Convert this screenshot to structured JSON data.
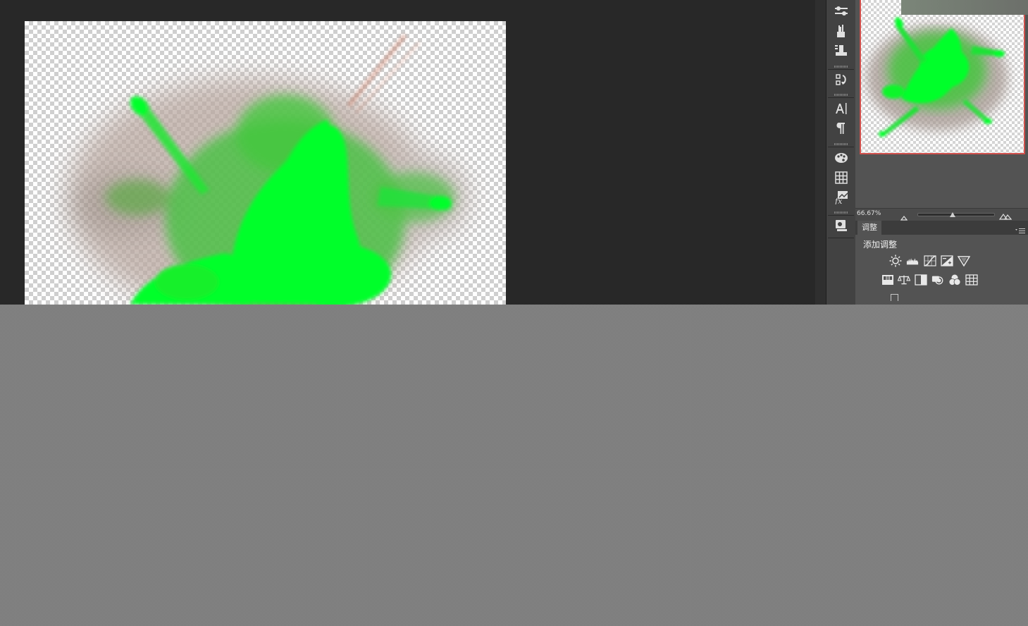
{
  "navigator": {
    "zoom_label": "66.67%"
  },
  "adjustments": {
    "tab_label": "调整",
    "add_adjustment_label": "添加调整",
    "row1_icons": [
      "brightness-contrast-icon",
      "levels-icon",
      "curves-icon",
      "exposure-icon",
      "vibrance-icon"
    ],
    "row2_icons": [
      "hue-saturation-icon",
      "color-balance-icon",
      "black-white-icon",
      "photo-filter-icon",
      "channel-mixer-icon",
      "color-lookup-icon"
    ]
  },
  "toolstrip": {
    "icons": [
      "adjustments-panel-icon",
      "brush-presets-icon",
      "clone-source-icon",
      "history-icon",
      "character-icon",
      "paragraph-icon",
      "swatches-icon",
      "navigator-grid-icon",
      "styles-fx-icon",
      "properties-icon"
    ]
  },
  "colors": {
    "splash_green": "#00ff2a",
    "workspace_bg": "#282828",
    "panel_bg": "#535353",
    "nav_proxy_border": "#d0504c"
  }
}
